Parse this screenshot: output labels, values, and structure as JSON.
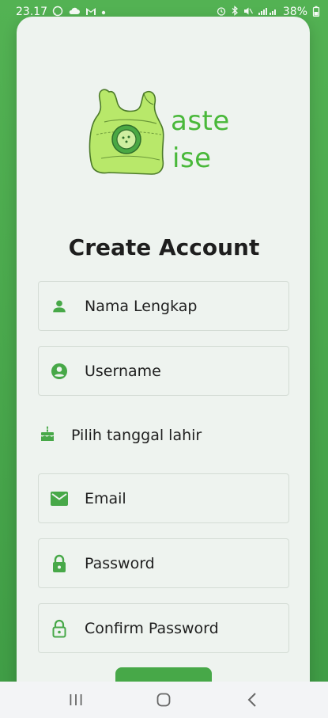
{
  "status_bar": {
    "time": "23.17",
    "battery": "38%"
  },
  "logo": {
    "line1": "aste",
    "line2": "ise"
  },
  "title": "Create Account",
  "fields": [
    {
      "label": "Nama Lengkap",
      "icon": "person-icon"
    },
    {
      "label": "Username",
      "icon": "account-circle-icon"
    },
    {
      "label": "Email",
      "icon": "mail-icon"
    },
    {
      "label": "Password",
      "icon": "lock-icon"
    },
    {
      "label": "Confirm Password",
      "icon": "lock-outline-icon"
    }
  ],
  "birthdate": {
    "label": "Pilih tanggal lahir",
    "icon": "cake-icon"
  },
  "colors": {
    "accent": "#47a848",
    "background": "#4aa44a",
    "card": "#eef3ef",
    "logo_green": "#49b83a"
  },
  "nav": {
    "icons": [
      "recent-apps-icon",
      "home-icon",
      "back-icon"
    ]
  }
}
